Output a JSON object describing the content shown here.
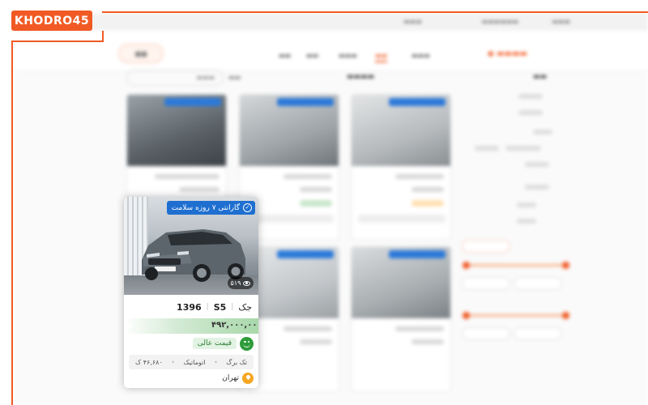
{
  "brand": {
    "name": "KHODRO45",
    "accent": "#f15a24"
  },
  "focused_card": {
    "warranty_badge": "گارانتی ۷ روزه سلامت",
    "views": "۵۱۹",
    "make": "جک",
    "model": "S5",
    "year": "1396",
    "price": "۴۹۲,۰۰۰,۰۰۰",
    "price_grade": "قیمت عالی",
    "specs": {
      "mileage": "۴۶,۶۸۰ ک",
      "transmission": "اتوماتیک",
      "color": "تک برگ"
    },
    "location": "تهران",
    "colors": {
      "badge": "#1f6fd1",
      "grade": "#2e9b3a",
      "pin": "#f5a623"
    }
  }
}
